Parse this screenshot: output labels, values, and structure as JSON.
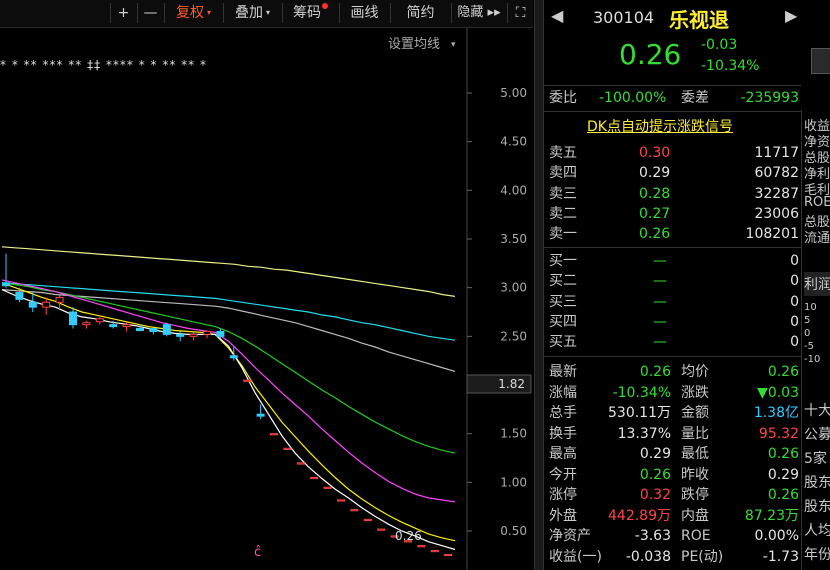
{
  "toolbar": {
    "items": [
      {
        "label": "+"
      },
      {
        "label": "—"
      },
      {
        "label": "复权",
        "caret": "▾",
        "active": true
      },
      {
        "label": "叠加",
        "caret": "▾"
      },
      {
        "label": "筹码"
      },
      {
        "label": "画线"
      },
      {
        "label": "简约"
      },
      {
        "label": "隐藏 ▸▸"
      },
      {
        "label": "⛶"
      }
    ]
  },
  "chart": {
    "setting_label": "设置均线",
    "setting_caret": "▾",
    "marker_row": "*  *  **  ***  **  ‡‡  ****  *  *  **   **  *",
    "yticks": [
      "5.00",
      "4.50",
      "4.00",
      "3.50",
      "3.00",
      "2.50",
      "2.00",
      "1.50",
      "1.00",
      "0.50"
    ],
    "ytick_values": [
      5.0,
      4.5,
      4.0,
      3.5,
      3.0,
      2.5,
      2.0,
      1.5,
      1.0,
      0.5
    ],
    "current_price": "1.82",
    "last_price_label": "0.26",
    "bottom_marker": "ĉ",
    "colors": {
      "up": "#ff4444",
      "down": "#33ccff",
      "ma5": "#ffffff",
      "ma10": "#ffee00",
      "ma20": "#ff44ff",
      "ma30": "#22cc22",
      "ma60": "#22ddee",
      "ma120": "#bbbbbb",
      "ma250": "#eeee88"
    }
  },
  "chart_data": {
    "type": "candlestick",
    "yrange": [
      0.3,
      5.3
    ],
    "candles": [
      {
        "o": 3.05,
        "h": 3.35,
        "l": 3.0,
        "c": 3.02
      },
      {
        "o": 2.95,
        "h": 3.0,
        "l": 2.85,
        "c": 2.88
      },
      {
        "o": 2.85,
        "h": 2.95,
        "l": 2.75,
        "c": 2.8
      },
      {
        "o": 2.8,
        "h": 2.9,
        "l": 2.72,
        "c": 2.85
      },
      {
        "o": 2.85,
        "h": 2.92,
        "l": 2.78,
        "c": 2.9
      },
      {
        "o": 2.75,
        "h": 2.8,
        "l": 2.58,
        "c": 2.62
      },
      {
        "o": 2.62,
        "h": 2.66,
        "l": 2.58,
        "c": 2.64
      },
      {
        "o": 2.65,
        "h": 2.7,
        "l": 2.62,
        "c": 2.68
      },
      {
        "o": 2.62,
        "h": 2.66,
        "l": 2.58,
        "c": 2.6
      },
      {
        "o": 2.6,
        "h": 2.64,
        "l": 2.55,
        "c": 2.62
      },
      {
        "o": 2.58,
        "h": 2.62,
        "l": 2.55,
        "c": 2.56
      },
      {
        "o": 2.58,
        "h": 2.6,
        "l": 2.52,
        "c": 2.55
      },
      {
        "o": 2.62,
        "h": 2.64,
        "l": 2.5,
        "c": 2.52
      },
      {
        "o": 2.52,
        "h": 2.55,
        "l": 2.45,
        "c": 2.5
      },
      {
        "o": 2.5,
        "h": 2.54,
        "l": 2.46,
        "c": 2.52
      },
      {
        "o": 2.52,
        "h": 2.56,
        "l": 2.48,
        "c": 2.55
      },
      {
        "o": 2.55,
        "h": 2.58,
        "l": 2.48,
        "c": 2.5
      },
      {
        "o": 2.3,
        "h": 2.4,
        "l": 2.25,
        "c": 2.28
      },
      {
        "o": 2.05,
        "h": 2.05,
        "l": 2.05,
        "c": 2.05
      },
      {
        "o": 1.7,
        "h": 1.8,
        "l": 1.65,
        "c": 1.68
      },
      {
        "o": 1.5,
        "h": 1.5,
        "l": 1.5,
        "c": 1.5
      },
      {
        "o": 1.35,
        "h": 1.35,
        "l": 1.35,
        "c": 1.35
      },
      {
        "o": 1.2,
        "h": 1.2,
        "l": 1.2,
        "c": 1.2
      },
      {
        "o": 1.05,
        "h": 1.05,
        "l": 1.05,
        "c": 1.05
      },
      {
        "o": 0.95,
        "h": 0.95,
        "l": 0.95,
        "c": 0.95
      },
      {
        "o": 0.82,
        "h": 0.82,
        "l": 0.82,
        "c": 0.82
      },
      {
        "o": 0.72,
        "h": 0.72,
        "l": 0.72,
        "c": 0.72
      },
      {
        "o": 0.62,
        "h": 0.62,
        "l": 0.62,
        "c": 0.62
      },
      {
        "o": 0.52,
        "h": 0.52,
        "l": 0.52,
        "c": 0.52
      },
      {
        "o": 0.45,
        "h": 0.45,
        "l": 0.45,
        "c": 0.45
      },
      {
        "o": 0.4,
        "h": 0.4,
        "l": 0.4,
        "c": 0.4
      },
      {
        "o": 0.35,
        "h": 0.35,
        "l": 0.35,
        "c": 0.35
      },
      {
        "o": 0.3,
        "h": 0.3,
        "l": 0.3,
        "c": 0.3
      },
      {
        "o": 0.26,
        "h": 0.26,
        "l": 0.26,
        "c": 0.26
      }
    ],
    "ma_lines": [
      {
        "key": "ma250",
        "values": [
          3.42,
          3.41,
          3.4,
          3.39,
          3.38,
          3.37,
          3.36,
          3.35,
          3.34,
          3.33,
          3.32,
          3.31,
          3.3,
          3.29,
          3.28,
          3.27,
          3.26,
          3.25,
          3.24,
          3.22,
          3.21,
          3.19,
          3.18,
          3.16,
          3.14,
          3.12,
          3.1,
          3.08,
          3.06,
          3.04,
          3.02,
          3.0,
          2.98,
          2.96,
          2.93,
          2.91
        ]
      },
      {
        "key": "ma60",
        "values": [
          3.05,
          3.04,
          3.03,
          3.02,
          3.01,
          3.0,
          2.99,
          2.98,
          2.97,
          2.96,
          2.95,
          2.94,
          2.93,
          2.92,
          2.91,
          2.9,
          2.89,
          2.87,
          2.85,
          2.83,
          2.81,
          2.79,
          2.77,
          2.75,
          2.72,
          2.7,
          2.67,
          2.64,
          2.62,
          2.59,
          2.56,
          2.53,
          2.5,
          2.48,
          2.46
        ]
      },
      {
        "key": "ma120",
        "values": [
          2.98,
          2.97,
          2.96,
          2.95,
          2.93,
          2.92,
          2.91,
          2.9,
          2.89,
          2.88,
          2.87,
          2.86,
          2.85,
          2.84,
          2.83,
          2.82,
          2.81,
          2.79,
          2.76,
          2.73,
          2.7,
          2.67,
          2.64,
          2.6,
          2.56,
          2.52,
          2.48,
          2.43,
          2.39,
          2.34,
          2.3,
          2.26,
          2.22,
          2.18,
          2.14
        ]
      },
      {
        "key": "ma30",
        "values": [
          3.05,
          3.03,
          3.01,
          2.98,
          2.96,
          2.93,
          2.9,
          2.87,
          2.84,
          2.81,
          2.78,
          2.75,
          2.72,
          2.69,
          2.66,
          2.63,
          2.6,
          2.55,
          2.48,
          2.4,
          2.31,
          2.22,
          2.13,
          2.04,
          1.95,
          1.87,
          1.78,
          1.7,
          1.62,
          1.55,
          1.48,
          1.42,
          1.37,
          1.33,
          1.3
        ]
      },
      {
        "key": "ma20",
        "values": [
          3.08,
          3.05,
          3.02,
          2.99,
          2.96,
          2.92,
          2.88,
          2.84,
          2.8,
          2.76,
          2.72,
          2.68,
          2.64,
          2.61,
          2.58,
          2.56,
          2.54,
          2.45,
          2.32,
          2.18,
          2.05,
          1.92,
          1.8,
          1.68,
          1.55,
          1.43,
          1.31,
          1.2,
          1.1,
          1.01,
          0.94,
          0.88,
          0.84,
          0.82,
          0.8
        ]
      },
      {
        "key": "ma10",
        "values": [
          3.05,
          3.0,
          2.95,
          2.9,
          2.86,
          2.8,
          2.75,
          2.72,
          2.69,
          2.66,
          2.63,
          2.6,
          2.58,
          2.56,
          2.55,
          2.54,
          2.52,
          2.38,
          2.2,
          1.98,
          1.8,
          1.62,
          1.47,
          1.32,
          1.18,
          1.05,
          0.93,
          0.83,
          0.74,
          0.66,
          0.59,
          0.53,
          0.47,
          0.43,
          0.4
        ]
      },
      {
        "key": "ma5",
        "values": [
          2.98,
          2.92,
          2.87,
          2.83,
          2.8,
          2.74,
          2.7,
          2.68,
          2.65,
          2.63,
          2.61,
          2.58,
          2.55,
          2.53,
          2.52,
          2.52,
          2.52,
          2.4,
          2.18,
          1.92,
          1.7,
          1.48,
          1.3,
          1.16,
          1.04,
          0.93,
          0.84,
          0.74,
          0.65,
          0.57,
          0.5,
          0.45,
          0.39,
          0.35,
          0.31
        ]
      }
    ]
  },
  "panel": {
    "code": "300104",
    "name": "乐视退",
    "price": "0.26",
    "change": "-0.03",
    "change_pct": "-10.34%",
    "weibi_label": "委比",
    "weibi": "-100.00%",
    "weicha_label": "委差",
    "weicha": "-235993",
    "dk_link": "DK点自动提示涨跌信号",
    "sell": [
      {
        "label": "卖五",
        "price": "0.30",
        "vol": "11717",
        "color": "red"
      },
      {
        "label": "卖四",
        "price": "0.29",
        "vol": "60782",
        "color": "white"
      },
      {
        "label": "卖三",
        "price": "0.28",
        "vol": "32287",
        "color": "green"
      },
      {
        "label": "卖二",
        "price": "0.27",
        "vol": "23006",
        "color": "green"
      },
      {
        "label": "卖一",
        "price": "0.26",
        "vol": "108201",
        "color": "green"
      }
    ],
    "buy": [
      {
        "label": "买一",
        "price": "—",
        "vol": "0"
      },
      {
        "label": "买二",
        "price": "—",
        "vol": "0"
      },
      {
        "label": "买三",
        "price": "—",
        "vol": "0"
      },
      {
        "label": "买四",
        "price": "—",
        "vol": "0"
      },
      {
        "label": "买五",
        "price": "—",
        "vol": "0"
      }
    ],
    "stats": [
      {
        "l1": "最新",
        "v1": "0.26",
        "c1": "green",
        "l2": "均价",
        "v2": "0.26",
        "c2": "green"
      },
      {
        "l1": "涨幅",
        "v1": "-10.34%",
        "c1": "green",
        "l2": "涨跌",
        "v2": "▼0.03",
        "c2": "green"
      },
      {
        "l1": "总手",
        "v1": "530.11万",
        "c1": "white",
        "l2": "金额",
        "v2": "1.38亿",
        "c2": "cyan"
      },
      {
        "l1": "换手",
        "v1": "13.37%",
        "c1": "white",
        "l2": "量比",
        "v2": "95.32",
        "c2": "red"
      },
      {
        "l1": "最高",
        "v1": "0.29",
        "c1": "white",
        "l2": "最低",
        "v2": "0.26",
        "c2": "green"
      },
      {
        "l1": "今开",
        "v1": "0.26",
        "c1": "green",
        "l2": "昨收",
        "v2": "0.29",
        "c2": "white"
      },
      {
        "l1": "涨停",
        "v1": "0.32",
        "c1": "red",
        "l2": "跌停",
        "v2": "0.26",
        "c2": "green"
      },
      {
        "l1": "外盘",
        "v1": "442.89万",
        "c1": "red",
        "l2": "内盘",
        "v2": "87.23万",
        "c2": "green"
      },
      {
        "l1": "净资产",
        "v1": "-3.63",
        "c1": "white",
        "l2": "ROE",
        "v2": "0.00%",
        "c2": "white"
      },
      {
        "l1": "收益(一)",
        "v1": "-0.038",
        "c1": "white",
        "l2": "PE(动)",
        "v2": "-1.73",
        "c2": "white"
      }
    ],
    "side_top": [
      "收益",
      "净资",
      "总股",
      "净利",
      "毛利",
      "ROE",
      "总股",
      "流通"
    ],
    "side_tab": "利润",
    "side_axis": [
      "10",
      "5",
      "0",
      "-5",
      "-10"
    ],
    "side_bottom": [
      "十大",
      "公募",
      "5家",
      "股东",
      "股东",
      "人均",
      "年份"
    ]
  }
}
